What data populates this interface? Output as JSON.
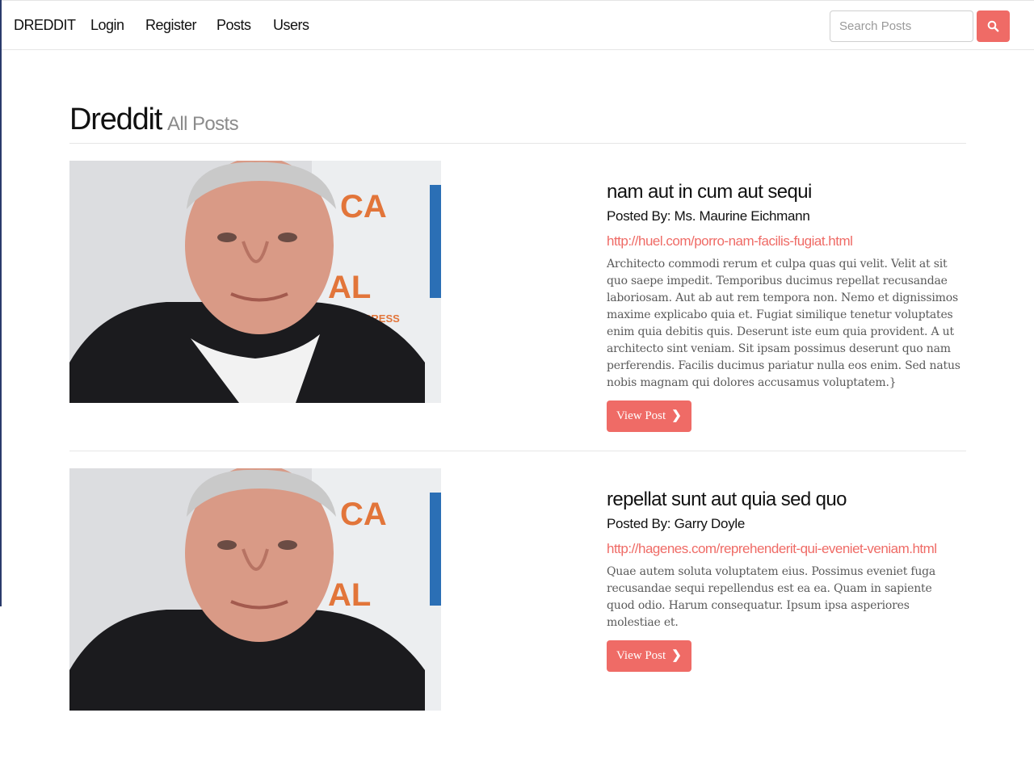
{
  "nav": {
    "brand": "DREDDIT",
    "links": [
      "Login",
      "Register",
      "Posts",
      "Users"
    ],
    "search_placeholder": "Search Posts",
    "search_icon": "search-icon"
  },
  "header": {
    "title": "Dreddit",
    "subtitle": "All Posts"
  },
  "posts": [
    {
      "image": "portrait-photo",
      "title": "nam aut in cum aut sequi",
      "author": "Posted By: Ms. Maurine Eichmann",
      "url": "http://huel.com/porro-nam-facilis-fugiat.html",
      "body": "Architecto commodi rerum et culpa quas qui velit. Velit at sit quo saepe impedit. Temporibus ducimus repellat recusandae laboriosam. Aut ab aut rem tempora non. Nemo et dignissimos maxime explicabo quia et. Fugiat similique tenetur voluptates enim quia debitis quis. Deserunt iste eum quia provident. A ut architecto sint veniam. Sit ipsam possimus deserunt quo nam perferendis. Facilis ducimus pariatur nulla eos enim. Sed natus nobis magnam qui dolores accusamus voluptatem.}",
      "button": "View Post"
    },
    {
      "image": "portrait-photo",
      "title": "repellat sunt aut quia sed quo",
      "author": "Posted By: Garry Doyle",
      "url": "http://hagenes.com/reprehenderit-qui-eveniet-veniam.html",
      "body": "Quae autem soluta voluptatem eius. Possimus eveniet fuga recusandae sequi repellendus est ea ea. Quam in sapiente quod odio. Harum consequatur. Ipsum ipsa asperiores molestiae et.",
      "button": "View Post"
    }
  ],
  "colors": {
    "accent": "#ef6b66",
    "muted_text": "#5a5a5a"
  }
}
